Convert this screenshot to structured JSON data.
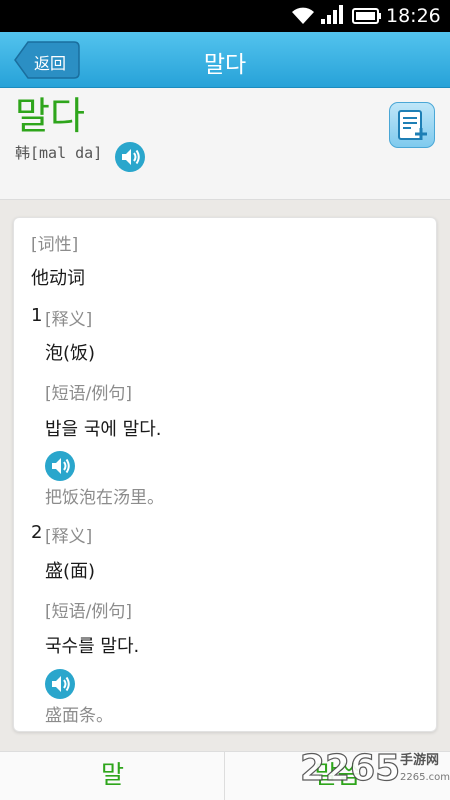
{
  "status_bar": {
    "time": "18:26"
  },
  "header": {
    "back_label": "返回",
    "title": "말다"
  },
  "word": {
    "headword": "말다",
    "pronunciation": "韩[mal da]"
  },
  "entry": {
    "pos_label": "[词性]",
    "pos": "他动词",
    "senses": [
      {
        "number": "1",
        "meaning_label": "[释义]",
        "meaning": "泡(饭)",
        "example_label": "[短语/例句]",
        "example": "밥을 국에 말다.",
        "translation": "把饭泡在汤里。"
      },
      {
        "number": "2",
        "meaning_label": "[释义]",
        "meaning": "盛(面)",
        "example_label": "[短语/例句]",
        "example": "국수를 말다.",
        "translation": "盛面条。"
      }
    ]
  },
  "bottom_tabs": [
    "말",
    "말씀"
  ],
  "watermark": {
    "text": "2265",
    "sub": "手游网",
    "domain": "2265.com"
  },
  "colors": {
    "accent": "#27a2d8",
    "green": "#2ea51b",
    "speaker": "#2aa6cc"
  }
}
